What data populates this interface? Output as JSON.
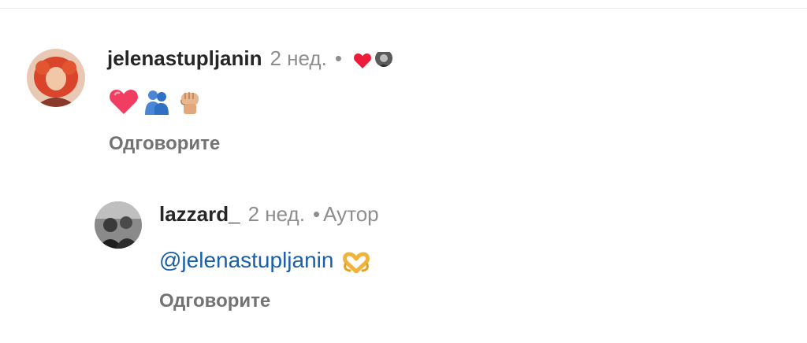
{
  "comments": [
    {
      "username": "jelenastupljanin",
      "time": "2 нед.",
      "separator": "•",
      "liked_by_author": true,
      "reactions": [
        "heart-emoji",
        "people-hugging-emoji",
        "raised-fist-emoji"
      ],
      "reply_label": "Одговорите"
    },
    {
      "username": "lazzard_",
      "time": "2 нед.",
      "separator": "•",
      "badge": "Аутор",
      "mention": "@jelenastupljanin",
      "reactions": [
        "heart-hands-emoji"
      ],
      "reply_label": "Одговорите"
    }
  ],
  "colors": {
    "username": "#262626",
    "secondary_text": "#8e8e8e",
    "mention": "#1a5fa8",
    "like_heart": "#ed1c3b"
  }
}
